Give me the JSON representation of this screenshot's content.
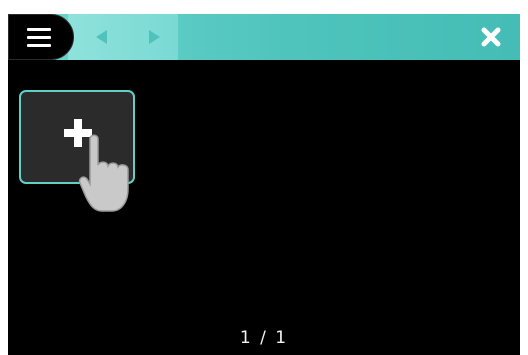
{
  "toolbar": {
    "menu_icon": "hamburger-menu-icon",
    "back_icon": "arrow-left-icon",
    "forward_icon": "arrow-right-icon",
    "close_icon": "close-icon",
    "bar_color": "#4ec4bd",
    "accent_color": "#5fd0c8"
  },
  "content": {
    "add_tile_icon": "plus-icon",
    "gesture_icon": "tap-hand-icon"
  },
  "pager": {
    "label": "1 / 1"
  }
}
